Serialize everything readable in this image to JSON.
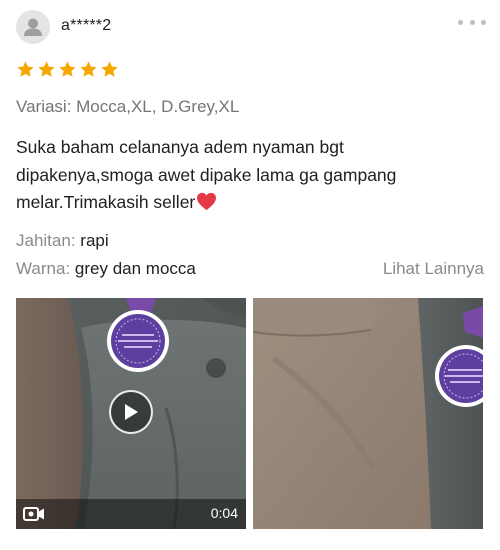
{
  "review": {
    "username": "a*****2",
    "rating": 5,
    "variant": "Variasi: Mocca,XL, D.Grey,XL",
    "comment": "Suka baham celananya adem nyaman bgt dipakenya,smoga awet dipake lama ga gampang melar.Trimakasih seller",
    "attributes": [
      {
        "key": "Jahitan:",
        "value": "rapi"
      },
      {
        "key": "Warna:",
        "value": "grey dan mocca"
      }
    ],
    "see_more": "Lihat Lainnya",
    "media": {
      "video_duration": "0:04"
    }
  },
  "colors": {
    "star": "#f6a700",
    "secondary_text": "#757575",
    "heart": "#e53945"
  },
  "icons": {
    "avatar": "user-silhouette",
    "more": "three-dots",
    "star": "star",
    "heart": "heart-emoji",
    "play": "play-triangle",
    "video": "video-camera"
  }
}
